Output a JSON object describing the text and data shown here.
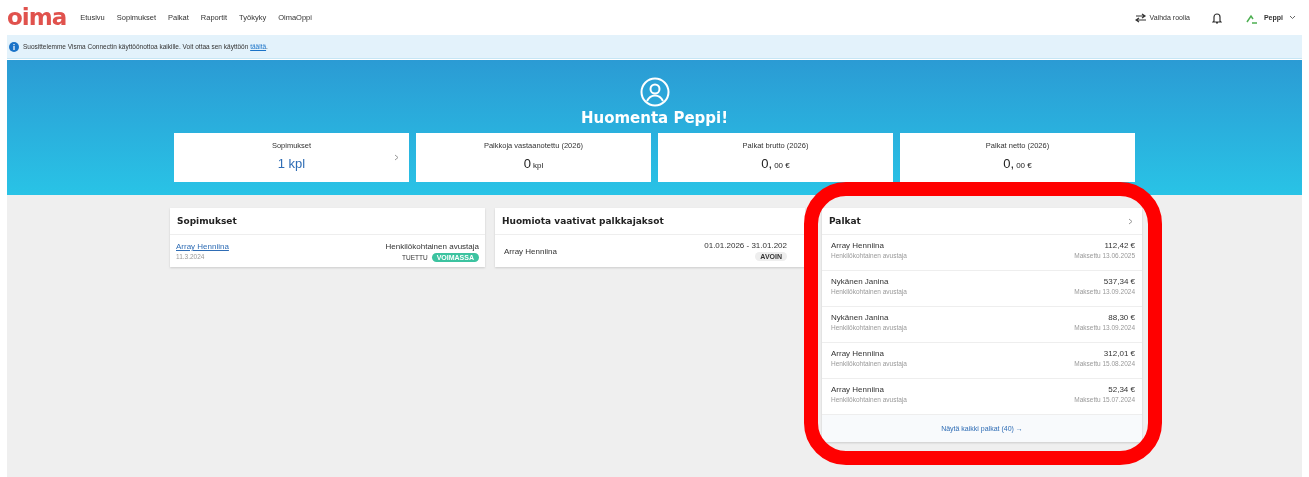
{
  "nav": {
    "logo": "oima",
    "items": [
      {
        "label": "Etusivu",
        "selected": false
      },
      {
        "label": "Sopimukset",
        "selected": false
      },
      {
        "label": "Palkat",
        "selected": false
      },
      {
        "label": "Raportit",
        "selected": false
      },
      {
        "label": "Työkyky",
        "selected": false
      },
      {
        "label": "OimaOppi",
        "selected": false
      }
    ],
    "switch_role": "Vaihda roolia",
    "user": "Peppi"
  },
  "notice": {
    "text": "Suosittelemme Visma Connectin käyttöönottoa kaikille. Voit ottaa sen käyttöön ",
    "link": "täältä",
    "end": "."
  },
  "hero": {
    "greeting": "Huomenta Peppi!"
  },
  "stats": [
    {
      "label": "Sopimukset",
      "value": "1 kpl",
      "link": true
    },
    {
      "label": "Palkkoja vastaanotettu (2026)",
      "value": "0",
      "unit": "kpl",
      "link": false
    },
    {
      "label": "Palkat brutto (2026)",
      "value": "0,",
      "unit": "00 €",
      "link": false
    },
    {
      "label": "Palkat netto (2026)",
      "value": "0,",
      "unit": "00 €",
      "link": false
    }
  ],
  "contracts": {
    "title": "Sopimukset",
    "rows": [
      {
        "name": "Array Henniina",
        "date": "11.3.2024",
        "role": "Henkilökohtainen avustaja",
        "type": "TUETTU",
        "status": "VOIMASSA"
      }
    ]
  },
  "periods": {
    "title": "Huomiota vaativat palkkajaksot",
    "rows": [
      {
        "name": "Array Henniina",
        "range": "01.01.2026 - 31.01.202",
        "status": "AVOIN"
      }
    ]
  },
  "salaries": {
    "title": "Palkat",
    "rows": [
      {
        "name": "Array Henniina",
        "role": "Henkilökohtainen avustaja",
        "amount": "112,42 €",
        "paid": "Maksettu 13.06.2025"
      },
      {
        "name": "Nykänen Janina",
        "role": "Henkilökohtainen avustaja",
        "amount": "537,34 €",
        "paid": "Maksettu 13.09.2024"
      },
      {
        "name": "Nykänen Janina",
        "role": "Henkilökohtainen avustaja",
        "amount": "88,30 €",
        "paid": "Maksettu 13.09.2024"
      },
      {
        "name": "Array Henniina",
        "role": "Henkilökohtainen avustaja",
        "amount": "312,01 €",
        "paid": "Maksettu 15.08.2024"
      },
      {
        "name": "Array Henniina",
        "role": "Henkilökohtainen avustaja",
        "amount": "52,34 €",
        "paid": "Maksettu 15.07.2024"
      }
    ],
    "show_all": "Näytä kaikki palkat (40) →",
    "highlighted": true
  }
}
